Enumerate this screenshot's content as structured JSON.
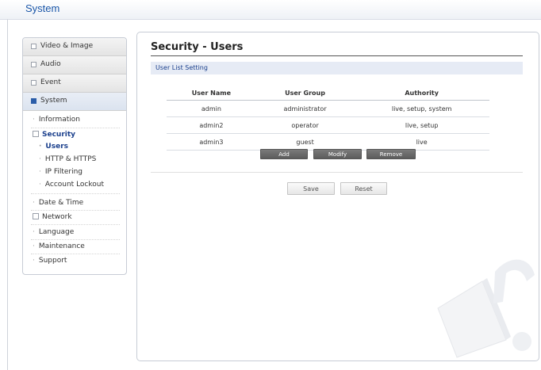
{
  "header": {
    "title": "System"
  },
  "sidebar": {
    "menus": [
      {
        "label": "Video & Image"
      },
      {
        "label": "Audio"
      },
      {
        "label": "Event"
      },
      {
        "label": "System"
      }
    ],
    "items": [
      {
        "label": "Information"
      },
      {
        "label": "Security"
      },
      {
        "label": "Users"
      },
      {
        "label": "HTTP & HTTPS"
      },
      {
        "label": "IP Filtering"
      },
      {
        "label": "Account Lockout"
      },
      {
        "label": "Date & Time"
      },
      {
        "label": "Network"
      },
      {
        "label": "Language"
      },
      {
        "label": "Maintenance"
      },
      {
        "label": "Support"
      }
    ]
  },
  "main": {
    "title": "Security - Users",
    "section": "User List Setting",
    "columns": [
      "User Name",
      "User Group",
      "Authority"
    ],
    "rows": [
      [
        "admin",
        "administrator",
        "live, setup, system"
      ],
      [
        "admin2",
        "operator",
        "live, setup"
      ],
      [
        "admin3",
        "guest",
        "live"
      ]
    ],
    "buttons": {
      "add": "Add",
      "modify": "Modify",
      "remove": "Remove",
      "save": "Save",
      "reset": "Reset"
    }
  }
}
